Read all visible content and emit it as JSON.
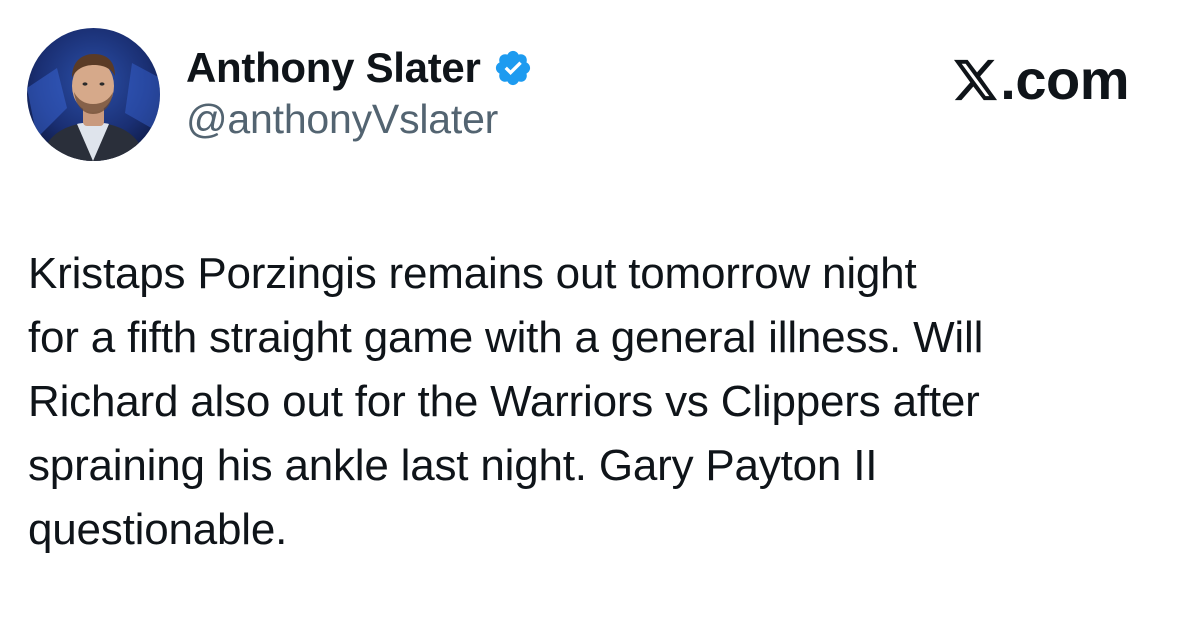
{
  "tweet": {
    "author": {
      "display_name": "Anthony Slater",
      "handle": "@anthonyVslater",
      "verified": true,
      "verified_icon": "verified-badge-icon",
      "verified_color": "#1d9bf0"
    },
    "brand": {
      "logo_icon": "x-logo-icon",
      "suffix": ".com"
    },
    "text_lines": [
      "Kristaps Porzingis remains out tomorrow night",
      "for a fifth straight game with a general illness. Will",
      "Richard also out for the Warriors vs Clippers after",
      "spraining his ankle last night. Gary Payton II",
      "questionable."
    ]
  },
  "colors": {
    "text_primary": "#0f1419",
    "text_secondary": "#536471",
    "background": "#ffffff"
  }
}
